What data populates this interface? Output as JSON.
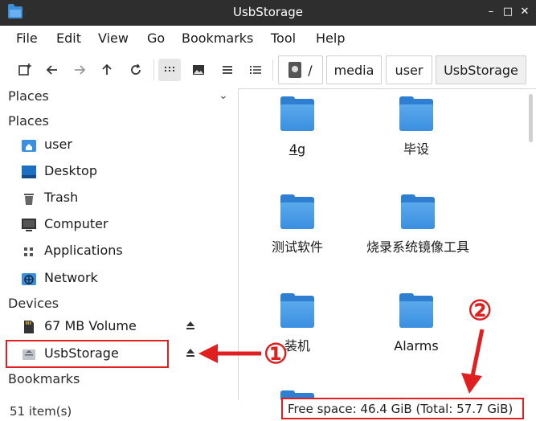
{
  "window": {
    "title": "UsbStorage",
    "minimize": "–",
    "maximize": "□",
    "close": "✕"
  },
  "menu": [
    "File",
    "Edit",
    "View",
    "Go",
    "Bookmarks",
    "Tool",
    "Help"
  ],
  "breadcrumb": {
    "root": "/",
    "parts": [
      "media",
      "user",
      "UsbStorage"
    ]
  },
  "sidebar": {
    "header": "Places",
    "sections": {
      "places": "Places",
      "devices": "Devices",
      "bookmarks": "Bookmarks"
    },
    "places": [
      {
        "label": "user",
        "icon": "home-folder-icon"
      },
      {
        "label": "Desktop",
        "icon": "desktop-icon"
      },
      {
        "label": "Trash",
        "icon": "trash-icon"
      },
      {
        "label": "Computer",
        "icon": "computer-icon"
      },
      {
        "label": "Applications",
        "icon": "applications-icon"
      },
      {
        "label": "Network",
        "icon": "network-icon"
      }
    ],
    "devices": [
      {
        "label": "67 MB Volume",
        "icon": "sd-card-icon"
      },
      {
        "label": "UsbStorage",
        "icon": "usb-drive-icon"
      }
    ]
  },
  "files": [
    {
      "name": "4g"
    },
    {
      "name": "毕设"
    },
    {
      "name": "测试软件"
    },
    {
      "name": "烧录系统镜像工具"
    },
    {
      "name": "装机"
    },
    {
      "name": "Alarms"
    }
  ],
  "status": {
    "items": "51 item(s)",
    "free_space": "Free space: 46.4 GiB (Total: 57.7 GiB)"
  },
  "annotations": {
    "one": "①",
    "two": "②"
  },
  "colors": {
    "titlebar": "#2e2e2e",
    "folder": "#2e7fd1",
    "annotation": "#e02020"
  }
}
